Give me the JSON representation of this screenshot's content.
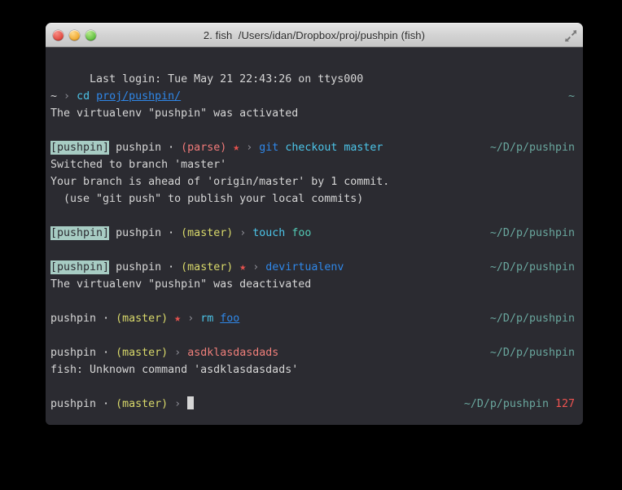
{
  "window": {
    "title": "2. fish  /Users/idan/Dropbox/proj/pushpin (fish)",
    "controls": {
      "close": "close-button",
      "minimize": "minimize-button",
      "zoom": "zoom-button",
      "fullscreen": "fullscreen-button"
    },
    "colors": {
      "background": "#2b2b31",
      "titlebar": "#d3d3d3",
      "accent_venv": "#a7ccc3",
      "accent_branch": "#d8d86a",
      "accent_error": "#ef5350",
      "accent_command": "#4cc4e8",
      "accent_link": "#2f87e8"
    }
  },
  "terminal": {
    "login_line": "Last login: Tue May 21 22:43:26 on ttys000",
    "lines": [
      {
        "type": "prompt",
        "venv": "",
        "host": "~",
        "dot": "",
        "branch": "",
        "star": "",
        "arrow": "›",
        "command": "cd",
        "args": "proj/pushpin/",
        "args_style": "link",
        "rprompt": "~",
        "status": ""
      },
      {
        "type": "output",
        "text": "The virtualenv \"pushpin\" was activated"
      },
      {
        "type": "blank"
      },
      {
        "type": "prompt",
        "venv": "[pushpin]",
        "host": "pushpin",
        "dot": "·",
        "branch": "(parse)",
        "branch_style": "red",
        "star": "★",
        "arrow": "›",
        "command": "git",
        "command_style": "git",
        "args": "checkout master",
        "args_style": "gitargs",
        "rprompt": "~/D/p/pushpin",
        "status": ""
      },
      {
        "type": "output",
        "text": "Switched to branch 'master'"
      },
      {
        "type": "output",
        "text": "Your branch is ahead of 'origin/master' by 1 commit."
      },
      {
        "type": "output",
        "text": "  (use \"git push\" to publish your local commits)"
      },
      {
        "type": "blank"
      },
      {
        "type": "prompt",
        "venv": "[pushpin]",
        "host": "pushpin",
        "dot": "·",
        "branch": "(master)",
        "branch_style": "yellow",
        "star": "",
        "arrow": "›",
        "command": "touch",
        "args": "foo",
        "args_style": "arg",
        "rprompt": "~/D/p/pushpin",
        "status": ""
      },
      {
        "type": "blank"
      },
      {
        "type": "prompt",
        "venv": "[pushpin]",
        "host": "pushpin",
        "dot": "·",
        "branch": "(master)",
        "branch_style": "yellow",
        "star": "★",
        "arrow": "›",
        "command": "devirtualenv",
        "command_style": "bluecmd",
        "args": "",
        "args_style": "",
        "rprompt": "~/D/p/pushpin",
        "status": ""
      },
      {
        "type": "output",
        "text": "The virtualenv \"pushpin\" was deactivated"
      },
      {
        "type": "blank"
      },
      {
        "type": "prompt",
        "venv": "",
        "host": "pushpin",
        "dot": "·",
        "branch": "(master)",
        "branch_style": "yellow",
        "star": "★",
        "arrow": "›",
        "command": "rm",
        "args": "foo",
        "args_style": "link",
        "rprompt": "~/D/p/pushpin",
        "status": ""
      },
      {
        "type": "blank"
      },
      {
        "type": "prompt",
        "venv": "",
        "host": "pushpin",
        "dot": "·",
        "branch": "(master)",
        "branch_style": "yellow",
        "star": "",
        "arrow": "›",
        "command": "asdklasdasdads",
        "command_style": "err",
        "args": "",
        "args_style": "",
        "rprompt": "~/D/p/pushpin",
        "status": ""
      },
      {
        "type": "output",
        "text": "fish: Unknown command 'asdklasdasdads'"
      },
      {
        "type": "blank"
      },
      {
        "type": "prompt",
        "venv": "",
        "host": "pushpin",
        "dot": "·",
        "branch": "(master)",
        "branch_style": "yellow",
        "star": "",
        "arrow": "›",
        "command": "",
        "args": "",
        "args_style": "",
        "cursor": true,
        "rprompt": "~/D/p/pushpin",
        "status": "127"
      }
    ]
  }
}
